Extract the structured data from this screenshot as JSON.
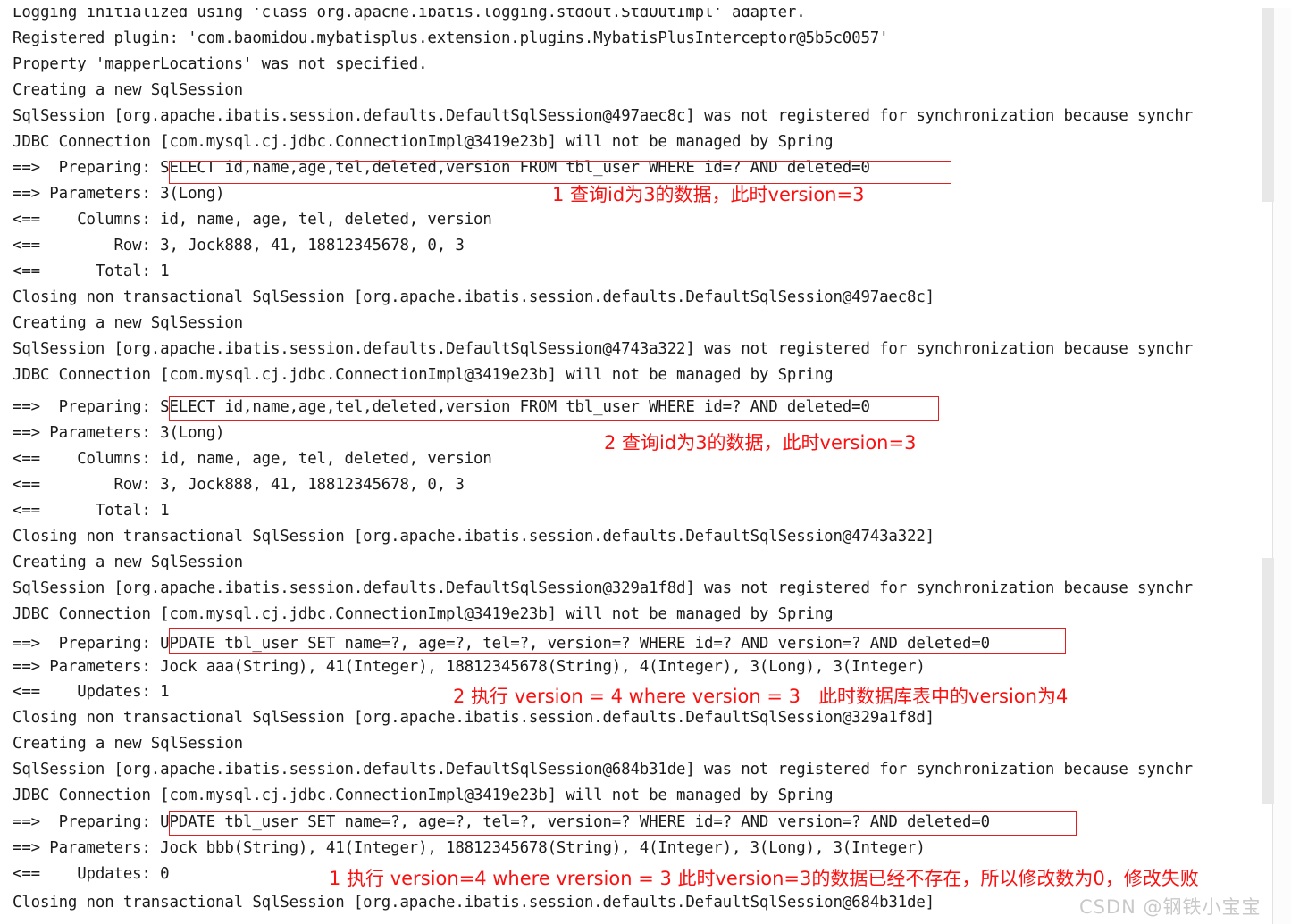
{
  "window": {
    "title": "IDEA Run Console — MyBatis-Plus optimistic lock log",
    "background_color": "#ffffff",
    "text_color": "#1b1b1b",
    "annotation_color": "#fb1010",
    "box_border_color": "#e02020",
    "scrollbar_thumb_color": "#e8e8e8"
  },
  "log": {
    "lines": [
      "Logging initialized using 'class org.apache.ibatis.logging.stdout.StdOutImpl' adapter.",
      "Registered plugin: 'com.baomidou.mybatisplus.extension.plugins.MybatisPlusInterceptor@5b5c0057'",
      "Property 'mapperLocations' was not specified.",
      "Creating a new SqlSession",
      "SqlSession [org.apache.ibatis.session.defaults.DefaultSqlSession@497aec8c] was not registered for synchronization because synchr",
      "JDBC Connection [com.mysql.cj.jdbc.ConnectionImpl@3419e23b] will not be managed by Spring",
      "==>  Preparing: SELECT id,name,age,tel,deleted,version FROM tbl_user WHERE id=? AND deleted=0",
      "==> Parameters: 3(Long)",
      "<==    Columns: id, name, age, tel, deleted, version",
      "<==        Row: 3, Jock888, 41, 18812345678, 0, 3",
      "<==      Total: 1",
      "Closing non transactional SqlSession [org.apache.ibatis.session.defaults.DefaultSqlSession@497aec8c]",
      "Creating a new SqlSession",
      "SqlSession [org.apache.ibatis.session.defaults.DefaultSqlSession@4743a322] was not registered for synchronization because synchr",
      "JDBC Connection [com.mysql.cj.jdbc.ConnectionImpl@3419e23b] will not be managed by Spring",
      "==>  Preparing: SELECT id,name,age,tel,deleted,version FROM tbl_user WHERE id=? AND deleted=0",
      "==> Parameters: 3(Long)",
      "<==    Columns: id, name, age, tel, deleted, version",
      "<==        Row: 3, Jock888, 41, 18812345678, 0, 3",
      "<==      Total: 1",
      "Closing non transactional SqlSession [org.apache.ibatis.session.defaults.DefaultSqlSession@4743a322]",
      "Creating a new SqlSession",
      "SqlSession [org.apache.ibatis.session.defaults.DefaultSqlSession@329a1f8d] was not registered for synchronization because synchr",
      "JDBC Connection [com.mysql.cj.jdbc.ConnectionImpl@3419e23b] will not be managed by Spring",
      "==>  Preparing: UPDATE tbl_user SET name=?, age=?, tel=?, version=? WHERE id=? AND version=? AND deleted=0",
      "==> Parameters: Jock aaa(String), 41(Integer), 18812345678(String), 4(Integer), 3(Long), 3(Integer)",
      "<==    Updates: 1",
      "Closing non transactional SqlSession [org.apache.ibatis.session.defaults.DefaultSqlSession@329a1f8d]",
      "Creating a new SqlSession",
      "SqlSession [org.apache.ibatis.session.defaults.DefaultSqlSession@684b31de] was not registered for synchronization because synchr",
      "JDBC Connection [com.mysql.cj.jdbc.ConnectionImpl@3419e23b] will not be managed by Spring",
      "==>  Preparing: UPDATE tbl_user SET name=?, age=?, tel=?, version=? WHERE id=? AND version=? AND deleted=0",
      "==> Parameters: Jock bbb(String), 41(Integer), 18812345678(String), 4(Integer), 3(Long), 3(Integer)",
      "<==    Updates: 0",
      "Closing non transactional SqlSession [org.apache.ibatis.session.defaults.DefaultSqlSession@684b31de]"
    ]
  },
  "annotations": [
    {
      "id": "annotation-select-1",
      "text": "1 查询id为3的数据，此时version=3"
    },
    {
      "id": "annotation-select-2",
      "text": "2 查询id为3的数据，此时version=3"
    },
    {
      "id": "annotation-update-success",
      "text": "2 执行 version = 4 where version = 3   此时数据库表中的version为4"
    },
    {
      "id": "annotation-update-fail",
      "text": "1 执行 version=4 where vrersion = 3 此时version=3的数据已经不存在，所以修改数为0，修改失败"
    }
  ],
  "watermark": {
    "text": "CSDN @钢铁小宝宝"
  }
}
